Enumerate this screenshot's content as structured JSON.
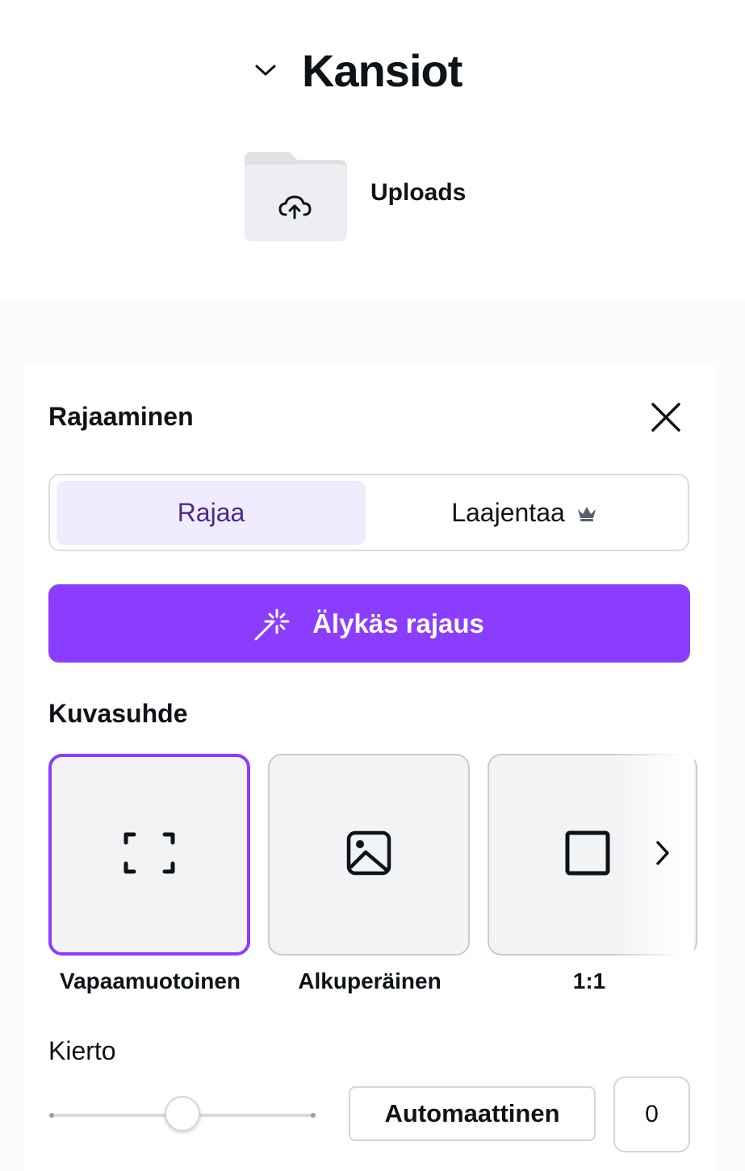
{
  "folders": {
    "title": "Kansiot",
    "items": [
      {
        "label": "Uploads",
        "icon": "cloud-upload-icon"
      }
    ]
  },
  "crop_panel": {
    "title": "Rajaaminen",
    "close_icon": "close-icon",
    "tabs": [
      {
        "label": "Rajaa",
        "selected": true
      },
      {
        "label": "Laajentaa",
        "selected": false,
        "badge_icon": "crown-icon"
      }
    ],
    "smart_crop": {
      "label": "Älykäs rajaus",
      "icon": "magic-sparkle-icon"
    },
    "aspect_ratio": {
      "heading": "Kuvasuhde",
      "options": [
        {
          "label": "Vapaamuotoinen",
          "icon": "freeform-corners-icon",
          "selected": true
        },
        {
          "label": "Alkuperäinen",
          "icon": "image-icon",
          "selected": false
        },
        {
          "label": "1:1",
          "icon": "square-icon",
          "selected": false
        }
      ],
      "scroll_icon": "chevron-right-icon"
    },
    "rotation": {
      "heading": "Kierto",
      "auto_label": "Automaattinen",
      "value": "0",
      "slider_position": 0.5
    }
  },
  "colors": {
    "accent": "#8b3dff",
    "selected_tab_bg": "#f0ebff",
    "selected_tab_text": "#4c2a86",
    "text": "#0e1318"
  }
}
